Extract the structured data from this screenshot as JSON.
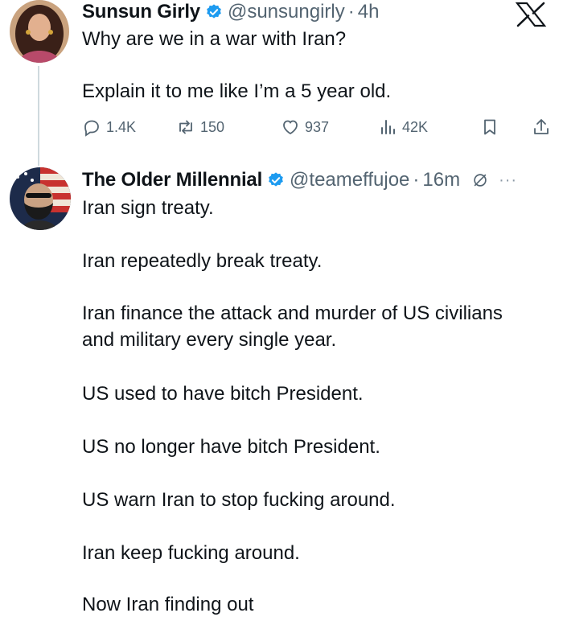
{
  "tweet1": {
    "name": "Sunsun Girly",
    "handle": "@sunsungirly",
    "separator": "·",
    "time": "4h",
    "lines": [
      "Why are we in a war with Iran?",
      "Explain it to me like I’m a 5 year old."
    ],
    "stats": {
      "replies": "1.4K",
      "reposts": "150",
      "likes": "937",
      "views": "42K"
    }
  },
  "tweet2": {
    "name": "The Older Millennial",
    "handle": "@teameffujoe",
    "separator": "·",
    "time": "16m",
    "more": "···",
    "lines": [
      "Iran sign treaty.",
      "Iran repeatedly break treaty.",
      "Iran finance the attack and murder of US civilians",
      "and military every single year.",
      "US used to have bitch President.",
      "US no longer have bitch President.",
      "US warn Iran to stop fucking around.",
      "Iran keep fucking around.",
      "Now Iran finding out"
    ]
  },
  "colors": {
    "accent": "#1d9bf0",
    "muted": "#536471",
    "text": "#0f1419",
    "thread": "#cfd9de"
  },
  "icons": [
    "x-logo-icon",
    "verified-badge-icon",
    "reply-icon",
    "repost-icon",
    "like-icon",
    "views-icon",
    "bookmark-icon",
    "share-icon",
    "muted-icon",
    "more-icon"
  ]
}
